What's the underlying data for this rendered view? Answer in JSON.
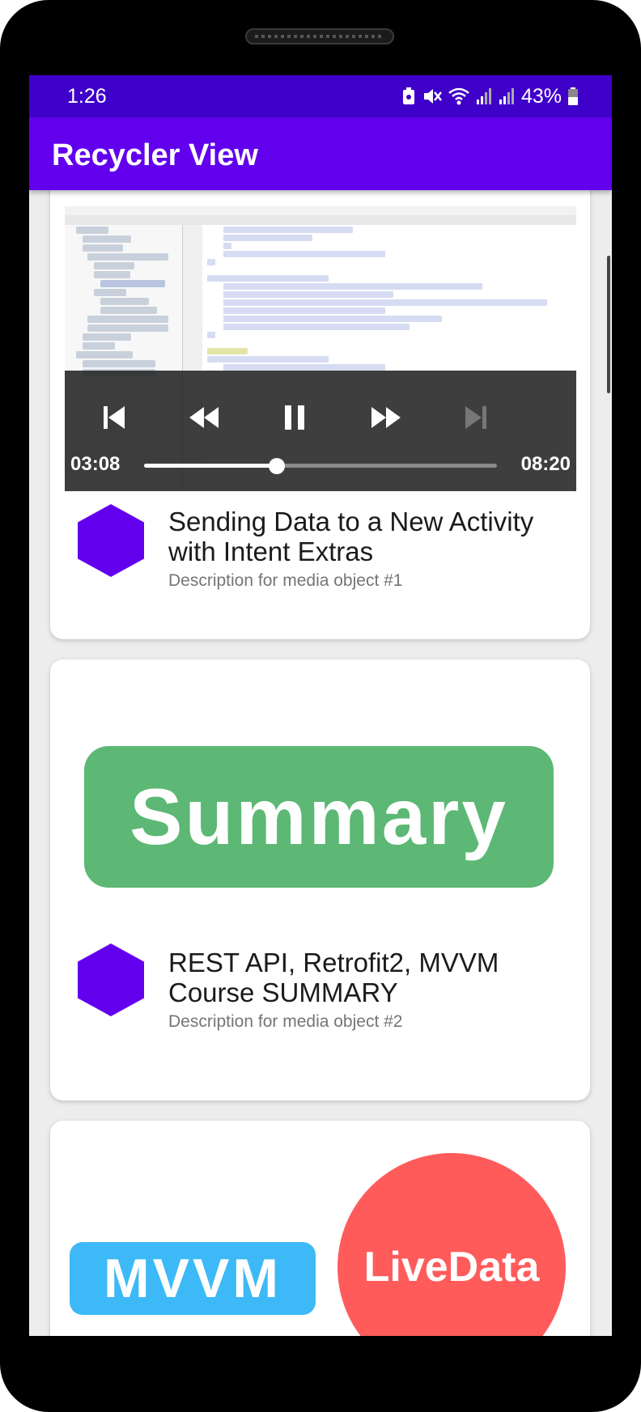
{
  "status": {
    "time": "1:26",
    "battery": "43%"
  },
  "app": {
    "title": "Recycler View"
  },
  "player": {
    "current_time": "03:08",
    "total_time": "08:20",
    "progress": 0.376
  },
  "items": [
    {
      "title": "Sending Data to a New Activity with Intent Extras",
      "description": "Description for media object #1"
    },
    {
      "thumbnail_text": "Summary",
      "title": "REST API, Retrofit2, MVVM Course SUMMARY",
      "description": "Description for media object #2"
    },
    {
      "thumbnail_left": "MVVM",
      "thumbnail_right": "LiveData"
    }
  ],
  "colors": {
    "status_bar": "#3f00c9",
    "app_bar": "#6200ee",
    "icon_accent": "#6200ee"
  }
}
